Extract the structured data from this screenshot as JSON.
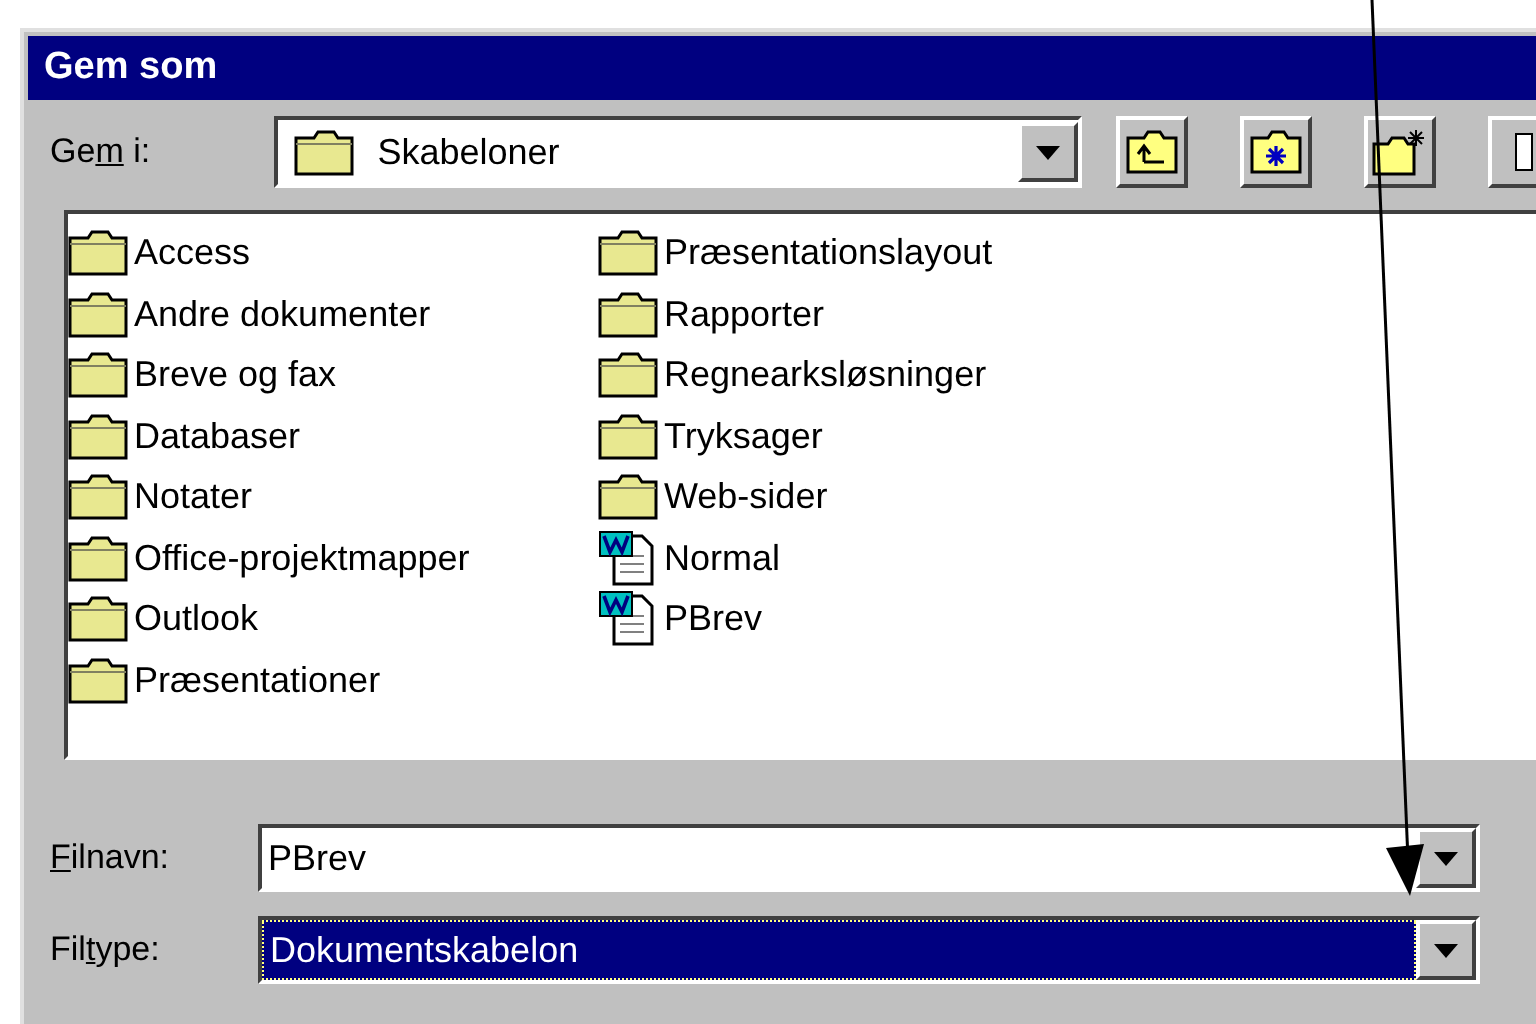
{
  "window": {
    "title": "Gem som"
  },
  "save_in": {
    "label": [
      {
        "text": "Ge",
        "underlined": false
      },
      {
        "text": "m",
        "underlined": true
      },
      {
        "text": " i:",
        "underlined": false
      }
    ],
    "value": "Skabeloner"
  },
  "toolbar": [
    {
      "kind": "up"
    },
    {
      "kind": "web"
    },
    {
      "kind": "new_folder"
    },
    {
      "kind": "view"
    }
  ],
  "files": {
    "columns": [
      [
        {
          "kind": "folder",
          "name": "Access"
        },
        {
          "kind": "folder",
          "name": "Andre dokumenter"
        },
        {
          "kind": "folder",
          "name": "Breve og fax"
        },
        {
          "kind": "folder",
          "name": "Databaser"
        },
        {
          "kind": "folder",
          "name": "Notater"
        },
        {
          "kind": "folder",
          "name": "Office-projektmapper"
        },
        {
          "kind": "folder",
          "name": "Outlook"
        },
        {
          "kind": "folder",
          "name": "Præsentationer"
        }
      ],
      [
        {
          "kind": "folder",
          "name": "Præsentationslayout"
        },
        {
          "kind": "folder",
          "name": "Rapporter"
        },
        {
          "kind": "folder",
          "name": "Regnearksløsninger"
        },
        {
          "kind": "folder",
          "name": "Tryksager"
        },
        {
          "kind": "folder",
          "name": "Web-sider"
        },
        {
          "kind": "template",
          "name": "Normal"
        },
        {
          "kind": "template",
          "name": "PBrev"
        }
      ]
    ]
  },
  "fields": [
    {
      "label": [
        {
          "text": "F",
          "underlined": true
        },
        {
          "text": "ilnavn:",
          "underlined": false
        }
      ],
      "value": "PBrev",
      "selected": false
    },
    {
      "label": [
        {
          "text": "Fil",
          "underlined": false
        },
        {
          "text": "t",
          "underlined": true
        },
        {
          "text": "ype:",
          "underlined": false
        }
      ],
      "value": "Dokumentskabelon",
      "selected": true
    }
  ]
}
